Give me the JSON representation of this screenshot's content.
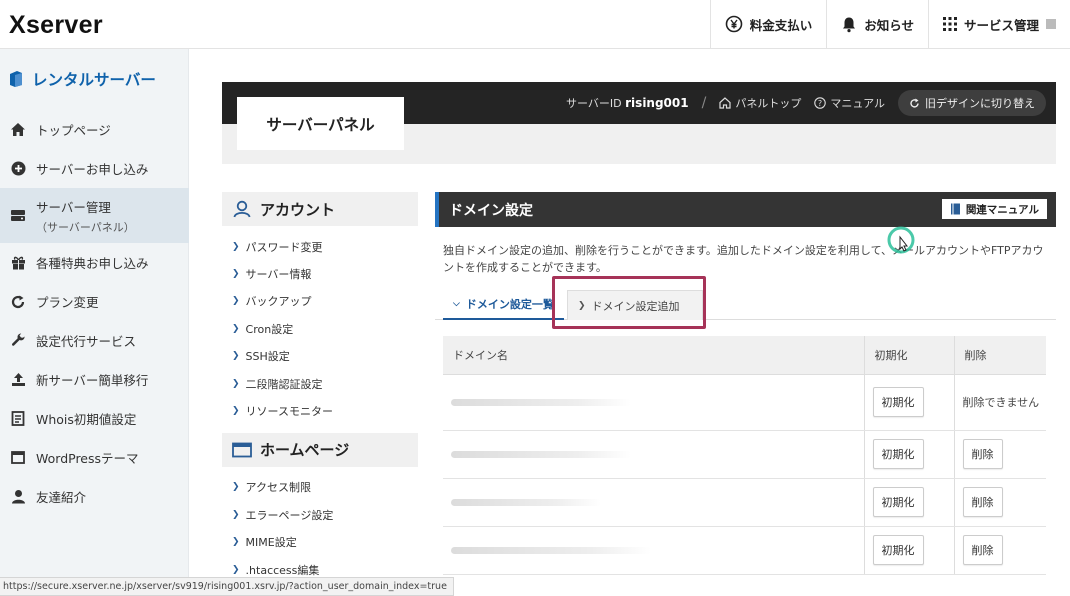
{
  "header": {
    "logo": "Xserver",
    "nav": [
      {
        "label": "料金支払い",
        "icon": "yen-icon"
      },
      {
        "label": "お知らせ",
        "icon": "bell-icon"
      },
      {
        "label": "サービス管理",
        "icon": "grid-icon"
      }
    ]
  },
  "sidebar": {
    "title": "レンタルサーバー",
    "items": [
      {
        "label": "トップページ",
        "icon": "home-icon"
      },
      {
        "label": "サーバーお申し込み",
        "icon": "plus-circle-icon"
      },
      {
        "label": "サーバー管理",
        "sub": "（サーバーパネル）",
        "icon": "server-icon",
        "active": true
      },
      {
        "label": "各種特典お申し込み",
        "icon": "gift-icon"
      },
      {
        "label": "プラン変更",
        "icon": "refresh-icon"
      },
      {
        "label": "設定代行サービス",
        "icon": "wrench-icon"
      },
      {
        "label": "新サーバー簡単移行",
        "icon": "upload-icon"
      },
      {
        "label": "Whois初期値設定",
        "icon": "document-icon"
      },
      {
        "label": "WordPressテーマ",
        "icon": "window-icon"
      },
      {
        "label": "友達紹介",
        "icon": "user-icon"
      }
    ]
  },
  "panel": {
    "title": "サーバーパネル",
    "server_id_label": "サーバーID",
    "server_id": "rising001",
    "separator": "/",
    "links": [
      {
        "label": "パネルトップ",
        "icon": "home-icon"
      },
      {
        "label": "マニュアル",
        "icon": "question-icon"
      }
    ],
    "switch_label": "旧デザインに切り替え"
  },
  "menu": {
    "sections": [
      {
        "title": "アカウント",
        "icon": "account-icon",
        "items": [
          "パスワード変更",
          "サーバー情報",
          "バックアップ",
          "Cron設定",
          "SSH設定",
          "二段階認証設定",
          "リソースモニター"
        ]
      },
      {
        "title": "ホームページ",
        "icon": "homepage-icon",
        "items": [
          "アクセス制限",
          "エラーページ設定",
          "MIME設定",
          ".htaccess編集"
        ]
      }
    ]
  },
  "content": {
    "title": "ドメイン設定",
    "manual_button": "関連マニュアル",
    "description": "独自ドメイン設定の追加、削除を行うことができます。追加したドメイン設定を利用して、メールアカウントやFTPアカウントを作成することができます。",
    "tabs": [
      {
        "label": "ドメイン設定一覧",
        "active": true
      },
      {
        "label": "ドメイン設定追加",
        "active": false
      }
    ],
    "table": {
      "headers": [
        "ドメイン名",
        "初期化",
        "削除"
      ],
      "reset_label": "初期化",
      "delete_label": "削除",
      "cannot_delete": "削除できません",
      "rows": [
        {
          "deletable": false
        },
        {
          "deletable": true
        },
        {
          "deletable": true
        },
        {
          "deletable": true
        }
      ]
    }
  },
  "statusbar": {
    "url": "https://secure.xserver.ne.jp/xserver/sv919/rising001.xsrv.jp/?action_user_domain_index=true"
  },
  "colors": {
    "accent_blue": "#0f62ab",
    "highlight": "#a63358",
    "dark_header": "#242424"
  }
}
